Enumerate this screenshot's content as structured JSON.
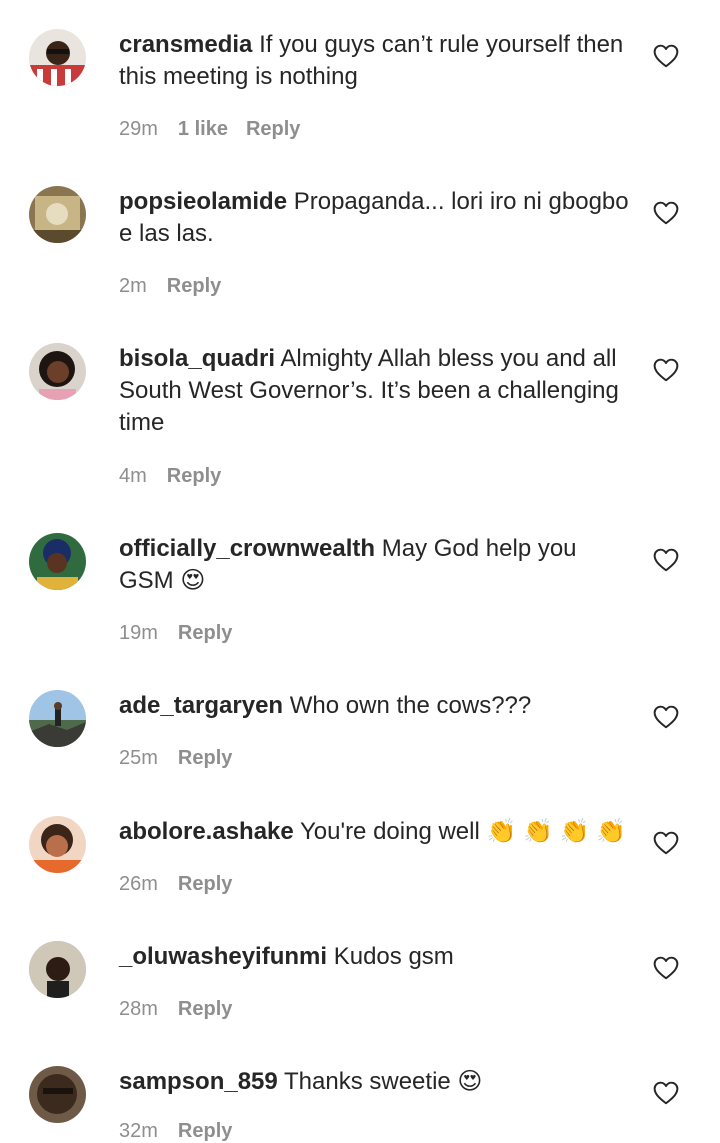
{
  "comments": [
    {
      "username": "cransmedia",
      "text": "If you guys can’t rule yourself then this meeting is nothing",
      "time": "29m",
      "likes": "1 like",
      "reply": "Reply"
    },
    {
      "username": "popsieolamide",
      "text": "Propaganda... lori iro ni gbogbo e las las.",
      "time": "2m",
      "reply": "Reply"
    },
    {
      "username": "bisola_quadri",
      "text": "Almighty Allah bless you and all South West Governor’s. It’s been a challenging time",
      "time": "4m",
      "reply": "Reply"
    },
    {
      "username": "officially_crownwealth",
      "text": "May God help you GSM 😍",
      "time": "19m",
      "reply": "Reply"
    },
    {
      "username": "ade_targaryen",
      "text": "Who own the cows???",
      "time": "25m",
      "reply": "Reply"
    },
    {
      "username": "abolore.ashake",
      "text": "You're doing well 👏 👏 👏 👏",
      "time": "26m",
      "reply": "Reply"
    },
    {
      "username": "_oluwasheyifunmi",
      "text": "Kudos gsm",
      "time": "28m",
      "reply": "Reply"
    },
    {
      "username": "sampson_859",
      "text": "Thanks sweetie 😍",
      "time": "32m",
      "reply": "Reply"
    }
  ],
  "icons": {
    "like": "heart-outline-icon",
    "avatar": "profile-photo"
  },
  "colors": {
    "text": "#262626",
    "secondary": "#8e8e8e",
    "background": "#ffffff"
  }
}
